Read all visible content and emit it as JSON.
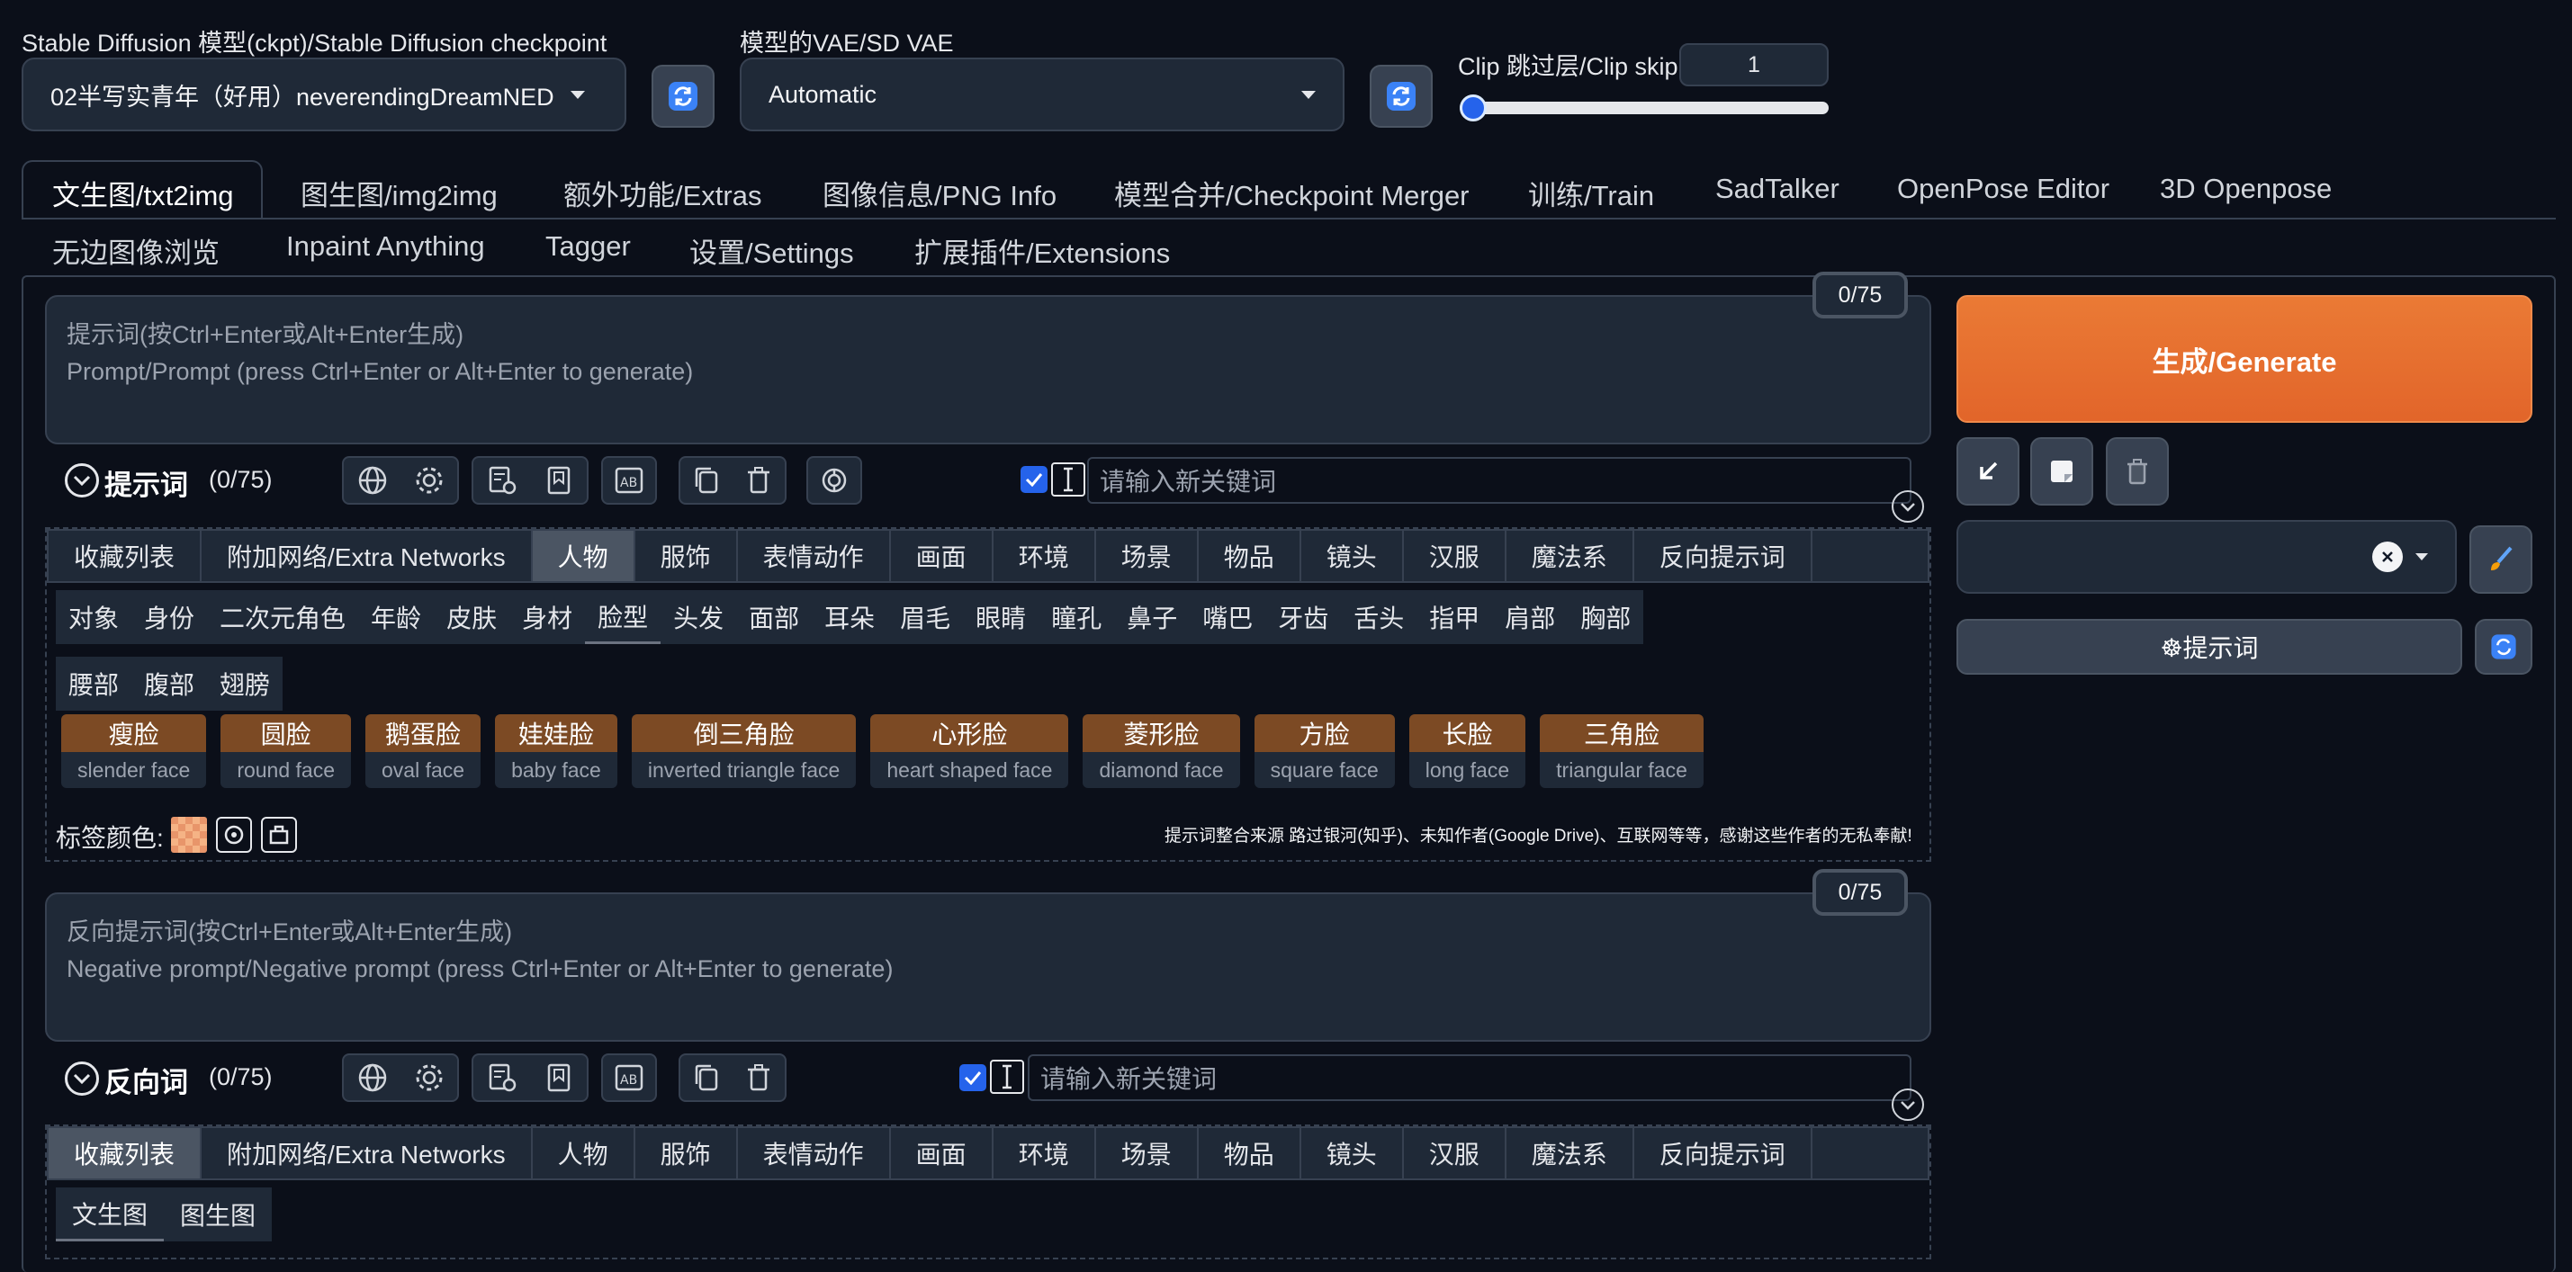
{
  "top": {
    "checkpoint_label": "Stable Diffusion 模型(ckpt)/Stable Diffusion checkpoint",
    "checkpoint_value": "02半写实青年（好用）neverendingDreamNED",
    "vae_label": "模型的VAE/SD VAE",
    "vae_value": "Automatic",
    "clip_label": "Clip 跳过层/Clip skip",
    "clip_value": "1",
    "clip_slider_fraction": 0.0
  },
  "tabs_row1": [
    {
      "label": "文生图/txt2img"
    },
    {
      "label": "图生图/img2img"
    },
    {
      "label": "额外功能/Extras"
    },
    {
      "label": "图像信息/PNG Info"
    },
    {
      "label": "模型合并/Checkpoint Merger"
    },
    {
      "label": "训练/Train"
    },
    {
      "label": "SadTalker"
    },
    {
      "label": "OpenPose Editor"
    },
    {
      "label": "3D Openpose"
    }
  ],
  "tabs_row2": [
    {
      "label": "无边图像浏览"
    },
    {
      "label": "Inpaint Anything"
    },
    {
      "label": "Tagger"
    },
    {
      "label": "设置/Settings"
    },
    {
      "label": "扩展插件/Extensions"
    }
  ],
  "prompt": {
    "placeholder_line1": "提示词(按Ctrl+Enter或Alt+Enter生成)",
    "placeholder_line2": "Prompt/Prompt (press Ctrl+Enter or Alt+Enter to generate)",
    "counter": "0/75",
    "section_title": "提示词",
    "section_count": "(0/75)",
    "keyword_placeholder": "请输入新关键词"
  },
  "categories": [
    "收藏列表",
    "附加网络/Extra Networks",
    "人物",
    "服饰",
    "表情动作",
    "画面",
    "环境",
    "场景",
    "物品",
    "镜头",
    "汉服",
    "魔法系",
    "反向提示词"
  ],
  "subcategories": [
    "对象",
    "身份",
    "二次元角色",
    "年龄",
    "皮肤",
    "身材",
    "脸型",
    "头发",
    "面部",
    "耳朵",
    "眉毛",
    "眼睛",
    "瞳孔",
    "鼻子",
    "嘴巴",
    "牙齿",
    "舌头",
    "指甲",
    "肩部",
    "胸部",
    "腰部",
    "腹部",
    "翅膀"
  ],
  "tags": [
    {
      "cn": "瘦脸",
      "en": "slender face"
    },
    {
      "cn": "圆脸",
      "en": "round face"
    },
    {
      "cn": "鹅蛋脸",
      "en": "oval face"
    },
    {
      "cn": "娃娃脸",
      "en": "baby face"
    },
    {
      "cn": "倒三角脸",
      "en": "inverted triangle face"
    },
    {
      "cn": "心形脸",
      "en": "heart shaped face"
    },
    {
      "cn": "菱形脸",
      "en": "diamond face"
    },
    {
      "cn": "方脸",
      "en": "square face"
    },
    {
      "cn": "长脸",
      "en": "long face"
    },
    {
      "cn": "三角脸",
      "en": "triangular face"
    }
  ],
  "tag_color_label": "标签颜色:",
  "credits": "提示词整合来源 路过银河(知乎)、未知作者(Google Drive)、互联网等等，感谢这些作者的无私奉献!",
  "negative": {
    "placeholder_line1": "反向提示词(按Ctrl+Enter或Alt+Enter生成)",
    "placeholder_line2": "Negative prompt/Negative prompt (press Ctrl+Enter or Alt+Enter to generate)",
    "counter": "0/75",
    "section_title": "反向词",
    "section_count": "(0/75)",
    "keyword_placeholder": "请输入新关键词"
  },
  "neg_subtabs": [
    "文生图",
    "图生图"
  ],
  "right": {
    "generate_label": "生成/Generate",
    "prompt_button_label": "☸提示词"
  },
  "colors": {
    "background": "#0b0f19",
    "panel": "#1f2937",
    "border": "#374151",
    "accent_orange": "#e8702f",
    "tag_brown": "#7c4a24",
    "checkbox_blue": "#2563eb"
  }
}
